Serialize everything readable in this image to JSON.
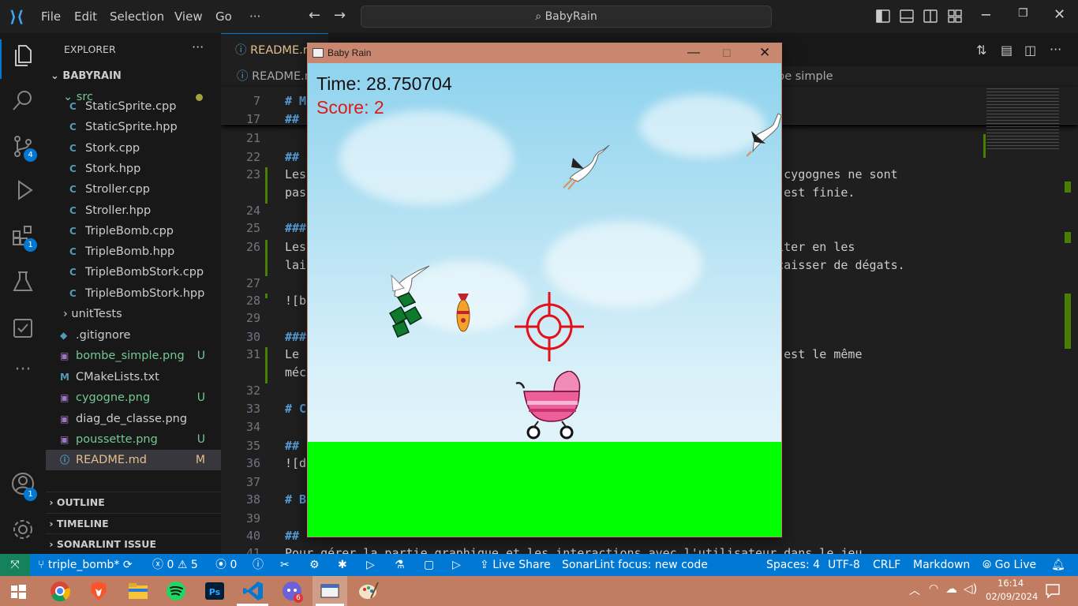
{
  "titlebar": {
    "menu": [
      "File",
      "Edit",
      "Selection",
      "View",
      "Go",
      "···"
    ],
    "search": "BabyRain"
  },
  "activity": {
    "scm_badge": "4",
    "ext_badge": "1",
    "account_badge": "1"
  },
  "sidebar": {
    "title": "EXPLORER",
    "more": "···",
    "root": "BABYRAIN",
    "src": "src",
    "files": [
      {
        "name": "StaticSprite.cpp",
        "icon": "C",
        "status": ""
      },
      {
        "name": "StaticSprite.hpp",
        "icon": "C",
        "status": ""
      },
      {
        "name": "Stork.cpp",
        "icon": "C",
        "status": ""
      },
      {
        "name": "Stork.hpp",
        "icon": "C",
        "status": ""
      },
      {
        "name": "Stroller.cpp",
        "icon": "C",
        "status": ""
      },
      {
        "name": "Stroller.hpp",
        "icon": "C",
        "status": ""
      },
      {
        "name": "TripleBomb.cpp",
        "icon": "C",
        "status": ""
      },
      {
        "name": "TripleBomb.hpp",
        "icon": "C",
        "status": ""
      },
      {
        "name": "TripleBombStork.cpp",
        "icon": "C",
        "status": ""
      },
      {
        "name": "TripleBombStork.hpp",
        "icon": "C",
        "status": ""
      }
    ],
    "unittests": "unitTests",
    "root_files": [
      {
        "name": ".gitignore",
        "icon": "◆",
        "status": "",
        "cls": ""
      },
      {
        "name": "bombe_simple.png",
        "icon": "▣",
        "status": "U",
        "cls": "green"
      },
      {
        "name": "CMakeLists.txt",
        "icon": "M",
        "status": "",
        "cls": ""
      },
      {
        "name": "cygogne.png",
        "icon": "▣",
        "status": "U",
        "cls": "green"
      },
      {
        "name": "diag_de_classe.png",
        "icon": "▣",
        "status": "",
        "cls": ""
      },
      {
        "name": "poussette.png",
        "icon": "▣",
        "status": "U",
        "cls": "green"
      },
      {
        "name": "README.md",
        "icon": "ⓘ",
        "status": "M",
        "cls": "yellow"
      }
    ],
    "sections": [
      "OUTLINE",
      "TIMELINE",
      "SONARLINT ISSUE LOCATIONS"
    ]
  },
  "editor": {
    "tab": "README.m",
    "breadcrumb_left": "README.md",
    "breadcrumb_right": "be simple",
    "lines": [
      {
        "n": "7",
        "text": "# M",
        "hdr": true
      },
      {
        "n": "17",
        "text": "##",
        "hdr": true
      },
      {
        "n": "21",
        "text": ""
      },
      {
        "n": "22",
        "text": "##",
        "hdr": true
      },
      {
        "n": "23",
        "text": "Les                                                          ent. Ces cygognes ne sont"
      },
      {
        "n": "",
        "text": "pas                                                          a partie est finie."
      },
      {
        "n": "24",
        "text": ""
      },
      {
        "n": "25",
        "text": "###",
        "hdr": true
      },
      {
        "n": "26",
        "text": "Les                                                          e les éviter en les"
      },
      {
        "n": "",
        "text": "lai                                                            pas encaisser de dégats."
      },
      {
        "n": "27",
        "text": ""
      },
      {
        "n": "28",
        "text": "![b"
      },
      {
        "n": "29",
        "text": ""
      },
      {
        "n": "30",
        "text": "###",
        "hdr": true
      },
      {
        "n": "31",
        "text": "Le                                                           égats, c'est le même"
      },
      {
        "n": "",
        "text": "méc"
      },
      {
        "n": "32",
        "text": ""
      },
      {
        "n": "33",
        "text": "# C",
        "hdr": true
      },
      {
        "n": "34",
        "text": ""
      },
      {
        "n": "35",
        "text": "##",
        "hdr": true
      },
      {
        "n": "36",
        "text": "![d"
      },
      {
        "n": "37",
        "text": ""
      },
      {
        "n": "38",
        "text": "# B",
        "hdr": true
      },
      {
        "n": "39",
        "text": ""
      },
      {
        "n": "40",
        "text": "##",
        "hdr": true
      },
      {
        "n": "41",
        "text": "Pour gérer la partie graphique et les interactions avec l'utilisateur dans le jeu."
      }
    ]
  },
  "statusbar": {
    "branch": "triple_bomb*",
    "errors": "0",
    "warnings": "5",
    "ports": "0",
    "liveshare": "Live Share",
    "sonarlint": "SonarLint focus: new code",
    "spaces": "Spaces: 4",
    "encoding": "UTF-8",
    "eol": "CRLF",
    "language": "Markdown",
    "golive": "Go Live"
  },
  "game": {
    "window_title": "Baby Rain",
    "time_label": "Time: 28.750704",
    "score_label": "Score: 2"
  },
  "taskbar": {
    "time": "16:14",
    "date": "02/09/2024",
    "browser_badge": "6"
  }
}
